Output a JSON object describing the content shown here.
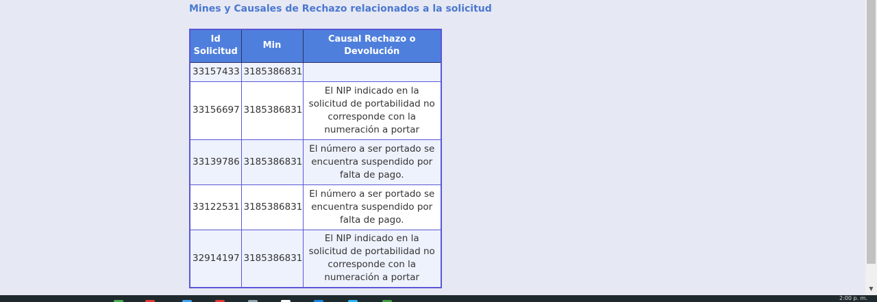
{
  "section_title": "Mines y Causales de Rechazo relacionados a la solicitud",
  "table": {
    "headers": {
      "id_line1": "Id",
      "id_line2": "Solicitud",
      "min": "Min",
      "causal": "Causal Rechazo o Devolución"
    },
    "rows": [
      {
        "id": "33157433",
        "min": "3185386831",
        "causal": ""
      },
      {
        "id": "33156697",
        "min": "3185386831",
        "causal": "El NIP indicado en la solicitud de portabilidad no corresponde con la numeración a portar"
      },
      {
        "id": "33139786",
        "min": "3185386831",
        "causal": "El número a ser portado se encuentra suspendido por falta de pago."
      },
      {
        "id": "33122531",
        "min": "3185386831",
        "causal": "El número a ser portado se encuentra suspendido por falta de pago."
      },
      {
        "id": "32914197",
        "min": "3185386831",
        "causal": "El NIP indicado en la solicitud de portabilidad no corresponde con la numeración a portar"
      }
    ]
  },
  "taskbar": {
    "clock": "2:00 p. m.",
    "icon_colors": [
      "#4caf50",
      "#e53935",
      "#42a5f5",
      "#e53935",
      "#90a4ae",
      "#ffffff",
      "#1e88e5",
      "#29b6f6",
      "#43a047"
    ]
  }
}
